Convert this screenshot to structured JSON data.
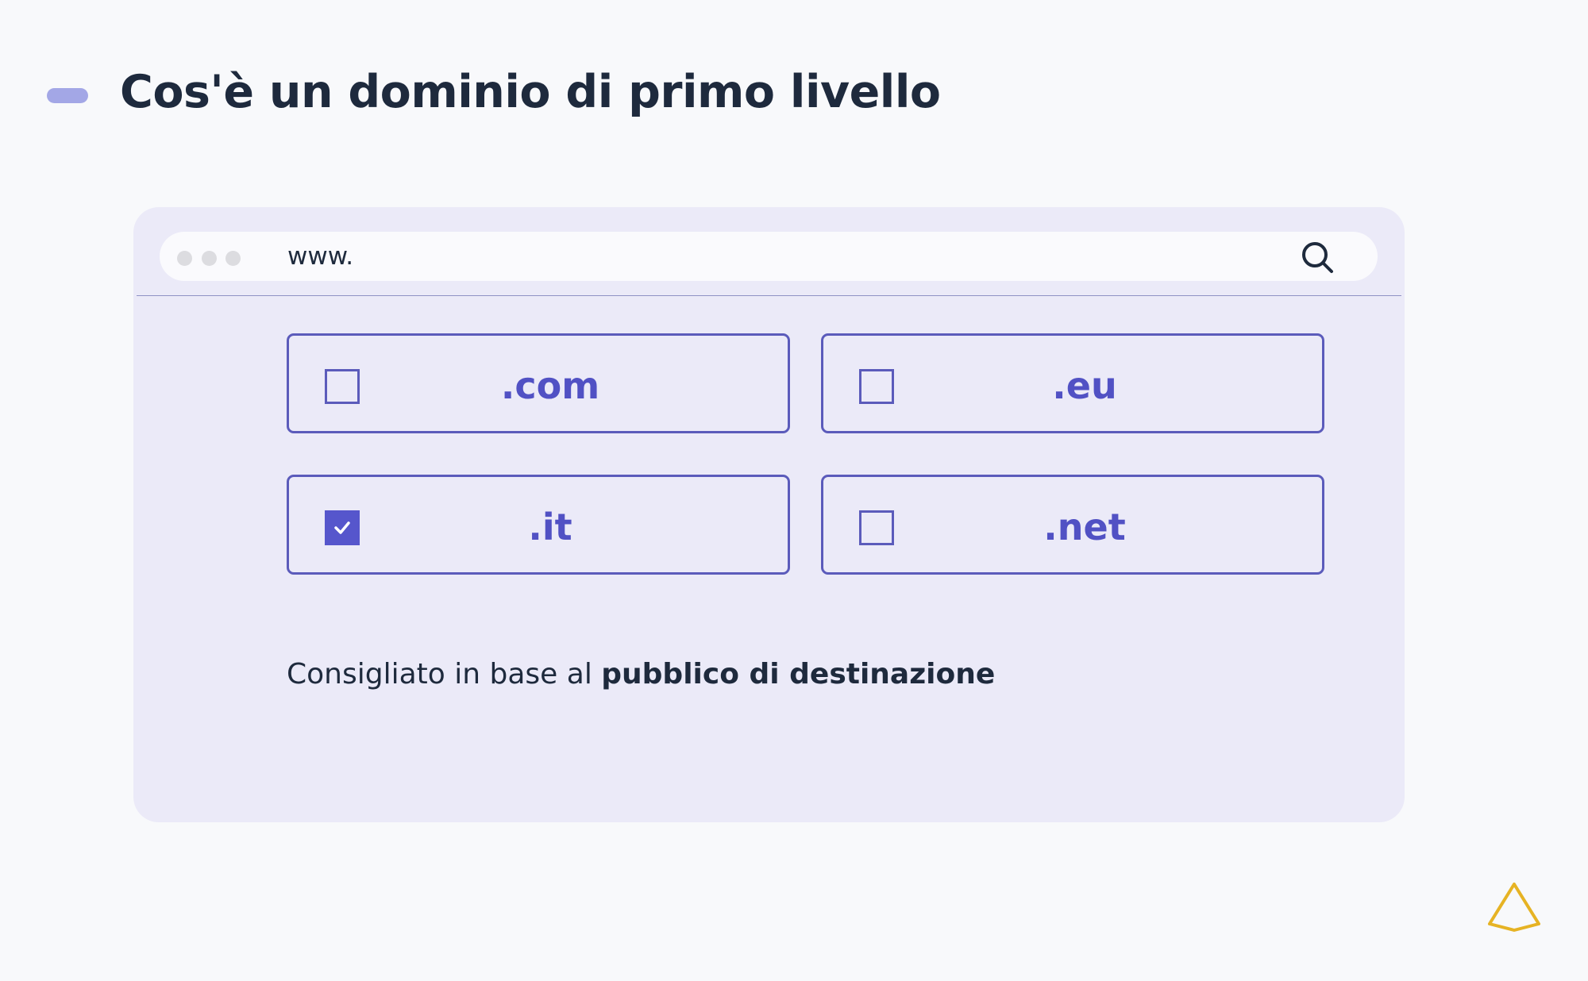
{
  "header": {
    "title": "Cos'è un dominio di primo livello"
  },
  "browser": {
    "url_text": "www.",
    "search_icon": "search-icon"
  },
  "options": [
    {
      "label": ".com",
      "checked": false
    },
    {
      "label": ".eu",
      "checked": false
    },
    {
      "label": ".it",
      "checked": true
    },
    {
      "label": ".net",
      "checked": false
    }
  ],
  "footer": {
    "prefix": "Consigliato in base al ",
    "emphasis": "pubblico di destinazione"
  },
  "colors": {
    "background": "#f8f9fb",
    "card": "#ebeaf8",
    "accent": "#5656cc",
    "title": "#1e2a3d",
    "marker": "#a3a7e6",
    "logo": "#e6b324"
  }
}
